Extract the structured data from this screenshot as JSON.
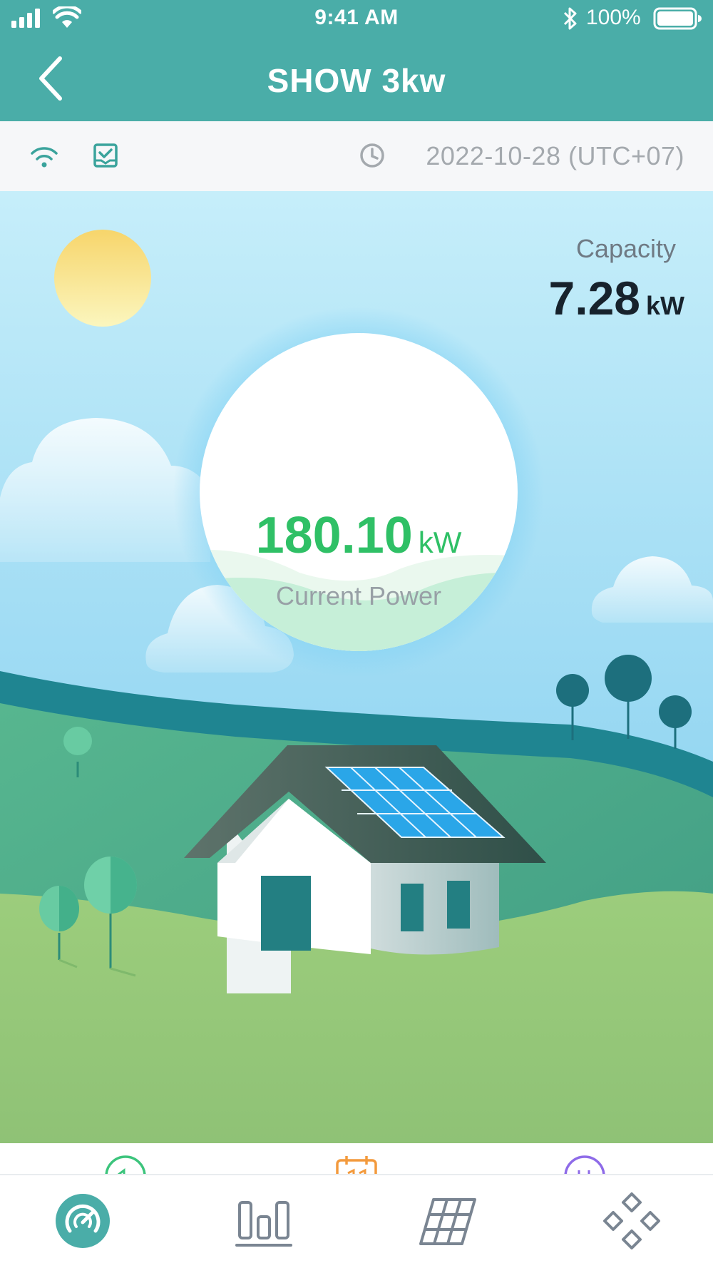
{
  "status_bar": {
    "time": "9:41 AM",
    "battery": "100%",
    "icons": [
      "signal-icon",
      "wifi-icon",
      "bluetooth-icon",
      "battery-icon"
    ]
  },
  "nav": {
    "title": "SHOW 3kw",
    "back_icon": "chevron-left-icon"
  },
  "info_strip": {
    "icons": [
      "wifi-icon",
      "report-icon",
      "clock-icon"
    ],
    "date": "2022-10-28 (UTC+07)"
  },
  "capacity": {
    "label": "Capacity",
    "value": "7.28",
    "unit": "kW"
  },
  "current_power": {
    "value": "180.10",
    "unit": "kW",
    "label": "Current Power"
  },
  "quick_icons": [
    {
      "name": "green-circle-icon",
      "color": "#3cc47c"
    },
    {
      "name": "calendar-icon",
      "color": "#f39a3d"
    },
    {
      "name": "purple-circle-icon",
      "color": "#8e6be8"
    }
  ],
  "tabs": [
    {
      "name": "overview-tab",
      "icon": "speedometer-icon",
      "active": true
    },
    {
      "name": "statistics-tab",
      "icon": "bar-chart-icon",
      "active": false
    },
    {
      "name": "solar-panel-tab",
      "icon": "solar-panel-icon",
      "active": false
    },
    {
      "name": "devices-tab",
      "icon": "grid-diamond-icon",
      "active": false
    }
  ],
  "colors": {
    "header": "#4aada8",
    "power_green": "#2fc066",
    "tab_active": "#4aada8",
    "tab_inactive": "#7a8592"
  }
}
